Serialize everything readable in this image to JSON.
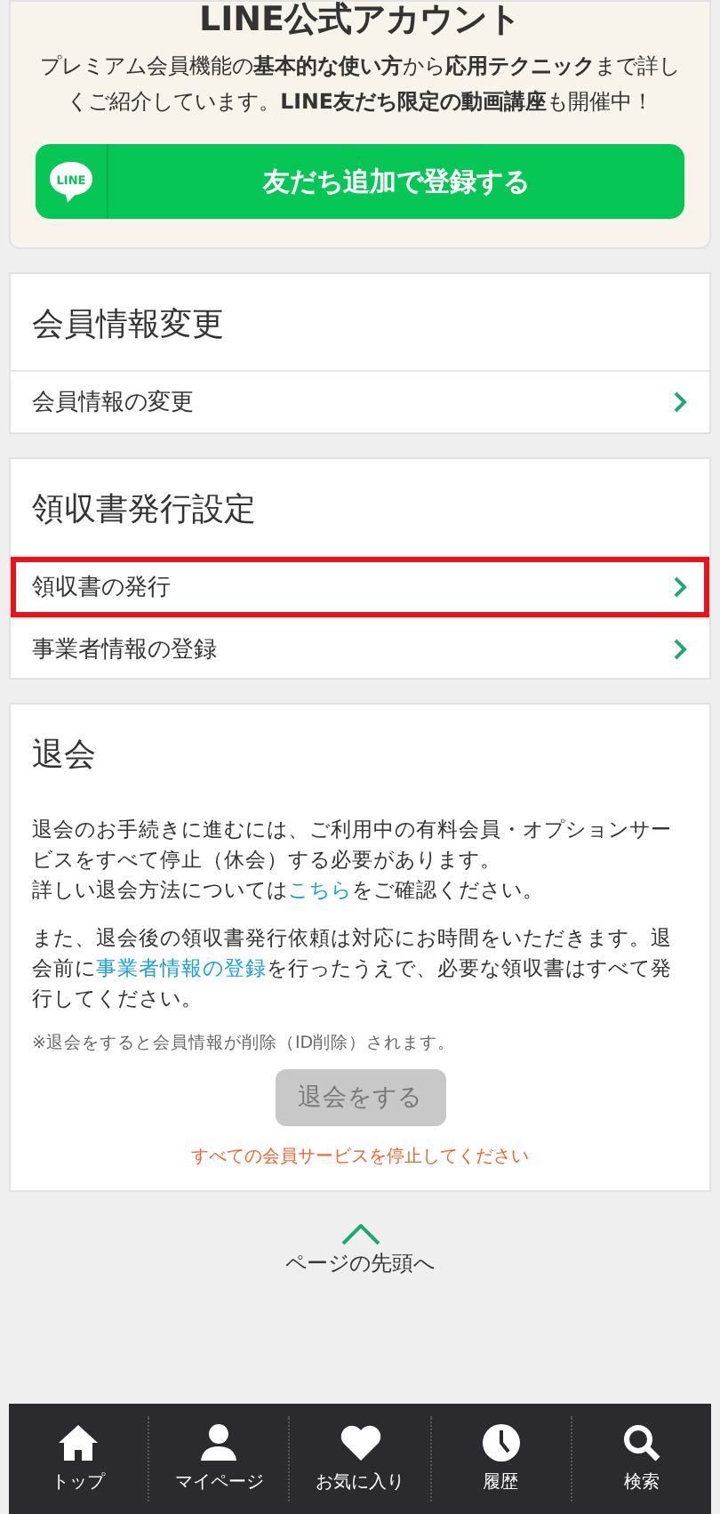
{
  "line_card": {
    "title": "LINE公式アカウント",
    "description": "プレミアム会員機能の**基本的な使い方**から**応用テクニック**まで詳しくご紹介しています。**LINE友だち限定の動画講座**も開催中！",
    "logo_text": "LINE",
    "button": "友だち追加で登録する"
  },
  "sections": [
    {
      "title": "会員情報変更",
      "items": [
        {
          "label": "会員情報の変更",
          "selected": false
        }
      ]
    },
    {
      "title": "領収書発行設定",
      "items": [
        {
          "label": "領収書の発行",
          "selected": true
        },
        {
          "label": "事業者情報の登録",
          "selected": false
        }
      ]
    }
  ],
  "withdraw": {
    "title": "退会",
    "paragraphs": [
      [
        {
          "kind": "text",
          "text": "退会のお手続きに進むには、ご利用中の有料会員・オプションサービスをすべて停止（休会）する必要があります。"
        },
        {
          "kind": "break"
        },
        {
          "kind": "text",
          "text": "詳しい退会方法については"
        },
        {
          "kind": "link",
          "text": "こちら"
        },
        {
          "kind": "text",
          "text": "をご確認ください。"
        }
      ],
      [
        {
          "kind": "text",
          "text": "また、退会後の領収書発行依頼は対応にお時間をいただきます。退会前に"
        },
        {
          "kind": "link",
          "text": "事業者情報の登録"
        },
        {
          "kind": "text",
          "text": "を行ったうえで、必要な領収書はすべて発行してください。"
        }
      ]
    ],
    "note": "※退会をすると会員情報が削除（ID削除）されます。",
    "button": {
      "label": "退会をする",
      "disabled": true
    },
    "warning": "すべての会員サービスを停止してください"
  },
  "page_top": "ページの先頭へ",
  "bottom_nav": [
    {
      "kind": "home",
      "label": "トップ"
    },
    {
      "kind": "person",
      "label": "マイページ"
    },
    {
      "kind": "heart",
      "label": "お気に入り"
    },
    {
      "kind": "clock",
      "label": "履歴"
    },
    {
      "kind": "search",
      "label": "検索"
    }
  ]
}
